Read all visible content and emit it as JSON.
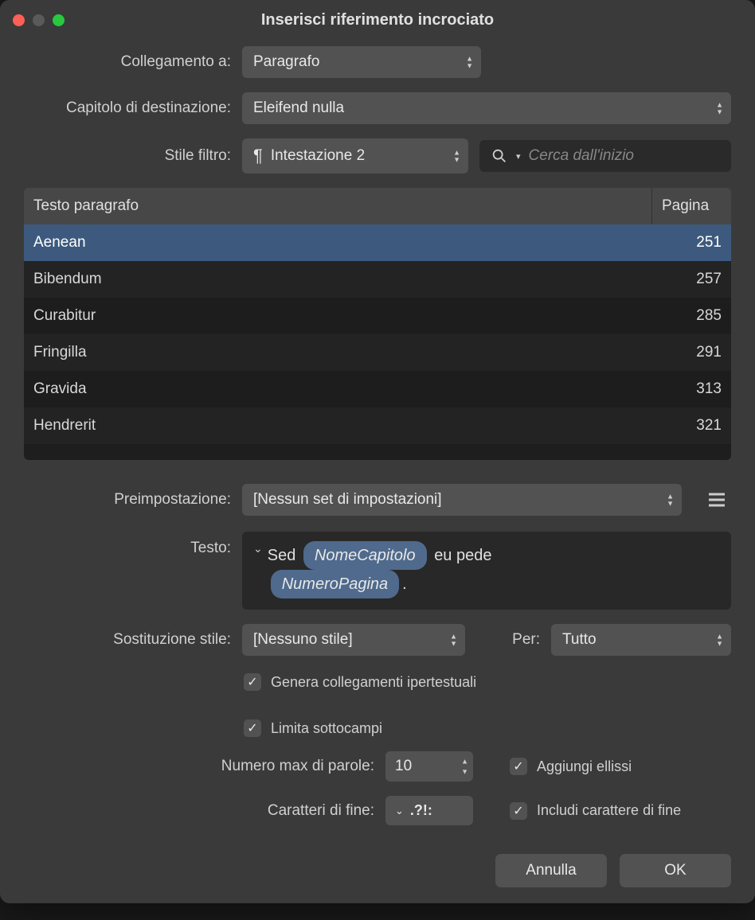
{
  "window": {
    "title": "Inserisci riferimento incrociato"
  },
  "labels": {
    "link_to": "Collegamento a:",
    "dest_chapter": "Capitolo di destinazione:",
    "filter_style": "Stile filtro:",
    "preset": "Preimpostazione:",
    "text": "Testo:",
    "style_sub": "Sostituzione stile:",
    "for": "Per:",
    "max_words": "Numero max di parole:",
    "end_chars": "Caratteri di fine:"
  },
  "selects": {
    "link_to": "Paragrafo",
    "dest_chapter": "Eleifend nulla",
    "filter_style": "Intestazione 2",
    "preset": "[Nessun set di impostazioni]",
    "style_sub": "[Nessuno stile]",
    "for": "Tutto"
  },
  "search": {
    "placeholder": "Cerca dall'inizio"
  },
  "table": {
    "head_text": "Testo paragrafo",
    "head_page": "Pagina",
    "rows": [
      {
        "text": "Aenean",
        "page": "251",
        "selected": true
      },
      {
        "text": "Bibendum",
        "page": "257",
        "selected": false
      },
      {
        "text": "Curabitur",
        "page": "285",
        "selected": false
      },
      {
        "text": "Fringilla",
        "page": "291",
        "selected": false
      },
      {
        "text": "Gravida",
        "page": "313",
        "selected": false
      },
      {
        "text": "Hendrerit",
        "page": "321",
        "selected": false
      }
    ]
  },
  "text_template": {
    "prefix": "Sed",
    "token1": "NomeCapitolo",
    "mid": "eu pede",
    "token2": "NumeroPagina",
    "suffix": "."
  },
  "checkboxes": {
    "hyperlinks": {
      "label": "Genera collegamenti ipertestuali",
      "checked": true
    },
    "limit_sub": {
      "label": "Limita sottocampi",
      "checked": true
    },
    "ellipsis": {
      "label": "Aggiungi ellissi",
      "checked": true
    },
    "include_end": {
      "label": "Includi carattere di fine",
      "checked": true
    }
  },
  "numbers": {
    "max_words": "10",
    "end_chars": ".?!:"
  },
  "buttons": {
    "cancel": "Annulla",
    "ok": "OK"
  }
}
